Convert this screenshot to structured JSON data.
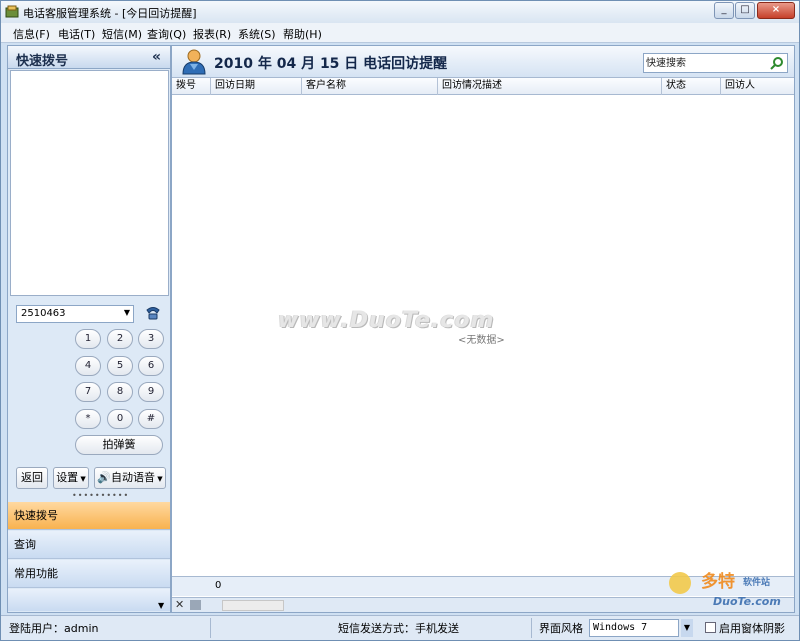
{
  "window": {
    "title": "电话客服管理系统 - [今日回访提醒]",
    "controls": [
      "_",
      "□",
      "×"
    ]
  },
  "menu": [
    "信息(F)",
    "电话(T)",
    "短信(M)",
    "查询(Q)",
    "报表(R)",
    "系统(S)",
    "帮助(H)"
  ],
  "left_panel": {
    "title": "快速拨号",
    "collapse_glyph": "«",
    "dial_number": "2510463",
    "keypad": [
      "1",
      "2",
      "3",
      "4",
      "5",
      "6",
      "7",
      "8",
      "9",
      "*",
      "0",
      "#"
    ],
    "hook_flash_label": "拍弹簧",
    "back_label": "返回",
    "settings_label": "设置",
    "auto_voice_label": "自动语音",
    "splitter_dots": "••••••••••",
    "nav": [
      "快速拨号",
      "查询",
      "常用功能"
    ]
  },
  "main": {
    "title": "2010 年 04 月 15 日 电话回访提醒",
    "search_placeholder": "快速搜索",
    "columns": [
      "拨号",
      "回访日期",
      "客户名称",
      "回访情况描述",
      "状态",
      "回访人"
    ],
    "empty_text": "<无数据>",
    "watermark": "www.DuoTe.com",
    "footer_count": "0"
  },
  "status_bar": {
    "user": "登陆用户：admin",
    "sms_mode": "短信发送方式：手机发送",
    "theme_label": "界面风格",
    "theme_value": "Windows 7",
    "shadow_label": "启用窗体阴影"
  },
  "corner_logo": {
    "brand": "多特",
    "subtitle": "软件站",
    "site": "DuoTe.com"
  },
  "colors": {
    "title_text": "#13274a",
    "nav_active": "#f8b24f",
    "nav_inactive": "#c9dbf1",
    "frame": "#cfe0f2"
  }
}
